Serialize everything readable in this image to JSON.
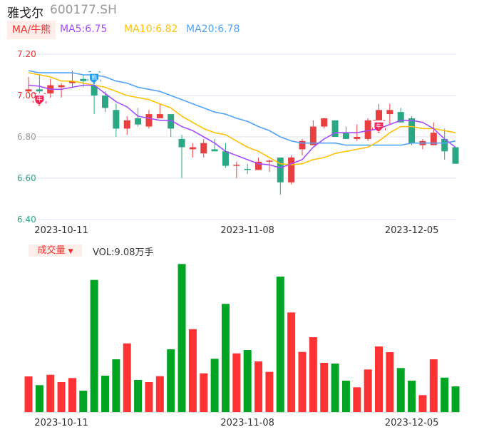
{
  "header": {
    "name": "雅戈尔",
    "code": "600177.SH"
  },
  "indicator": {
    "selector_label": "MA/牛熊",
    "ma5": {
      "label": "MA5:6.75",
      "color": "#a64dff"
    },
    "ma10": {
      "label": "MA10:6.82",
      "color": "#ffc107"
    },
    "ma20": {
      "label": "MA20:6.78",
      "color": "#4fa3f7"
    }
  },
  "volume_panel": {
    "selector_label": "成交量",
    "value_label": "VOL:9.08万手"
  },
  "colors": {
    "up": "#e84040",
    "down": "#2aa784",
    "vol_up": "#ff3333",
    "vol_down": "#00a524",
    "grid": "#dde3ef"
  },
  "chart_data": {
    "type": "candlestick",
    "y_ticks": [
      "7.20",
      "7.00",
      "6.80",
      "6.60",
      "6.40"
    ],
    "ylim": [
      6.4,
      7.2
    ],
    "x_tick_labels": [
      {
        "index": 3,
        "label": "2023-10-11"
      },
      {
        "index": 20,
        "label": "2023-11-08"
      },
      {
        "index": 35,
        "label": "2023-12-05"
      }
    ],
    "ohlc": [
      [
        7.02,
        7.09,
        7.01,
        7.03
      ],
      [
        7.03,
        7.1,
        7.01,
        7.02
      ],
      [
        7.01,
        7.08,
        6.99,
        7.05
      ],
      [
        7.04,
        7.06,
        6.99,
        7.05
      ],
      [
        7.06,
        7.12,
        7.04,
        7.07
      ],
      [
        7.08,
        7.1,
        7.04,
        7.07
      ],
      [
        7.05,
        7.06,
        6.91,
        7.0
      ],
      [
        7.0,
        7.02,
        6.92,
        6.94
      ],
      [
        6.93,
        6.96,
        6.8,
        6.84
      ],
      [
        6.84,
        6.9,
        6.81,
        6.88
      ],
      [
        6.89,
        6.94,
        6.85,
        6.86
      ],
      [
        6.85,
        6.93,
        6.84,
        6.91
      ],
      [
        6.89,
        6.96,
        6.89,
        6.91
      ],
      [
        6.91,
        6.91,
        6.8,
        6.84
      ],
      [
        6.79,
        6.81,
        6.6,
        6.75
      ],
      [
        6.74,
        6.77,
        6.7,
        6.75
      ],
      [
        6.72,
        6.79,
        6.7,
        6.77
      ],
      [
        6.74,
        6.79,
        6.73,
        6.73
      ],
      [
        6.73,
        6.77,
        6.65,
        6.66
      ],
      [
        6.66,
        6.68,
        6.6,
        6.665
      ],
      [
        6.645,
        6.67,
        6.62,
        6.64
      ],
      [
        6.64,
        6.7,
        6.64,
        6.68
      ],
      [
        6.68,
        6.69,
        6.63,
        6.685
      ],
      [
        6.7,
        6.7,
        6.52,
        6.58
      ],
      [
        6.58,
        6.71,
        6.57,
        6.7
      ],
      [
        6.74,
        6.79,
        6.71,
        6.78
      ],
      [
        6.76,
        6.88,
        6.76,
        6.85
      ],
      [
        6.85,
        6.89,
        6.84,
        6.89
      ],
      [
        6.88,
        6.88,
        6.8,
        6.8
      ],
      [
        6.82,
        6.85,
        6.79,
        6.79
      ],
      [
        6.79,
        6.86,
        6.78,
        6.8
      ],
      [
        6.79,
        6.89,
        6.78,
        6.88
      ],
      [
        6.88,
        6.96,
        6.88,
        6.93
      ],
      [
        6.91,
        6.96,
        6.86,
        6.93
      ],
      [
        6.92,
        6.94,
        6.87,
        6.87
      ],
      [
        6.89,
        6.9,
        6.76,
        6.77
      ],
      [
        6.76,
        6.79,
        6.74,
        6.78
      ],
      [
        6.76,
        6.87,
        6.76,
        6.82
      ],
      [
        6.79,
        6.84,
        6.69,
        6.73
      ],
      [
        6.75,
        6.75,
        6.67,
        6.67
      ]
    ],
    "ma5": [
      7.05,
      7.045,
      7.03,
      7.03,
      7.04,
      7.05,
      7.05,
      7.01,
      6.97,
      6.945,
      6.9,
      6.89,
      6.88,
      6.88,
      6.85,
      6.83,
      6.8,
      6.77,
      6.73,
      6.71,
      6.69,
      6.67,
      6.665,
      6.65,
      6.67,
      6.69,
      6.75,
      6.79,
      6.82,
      6.82,
      6.82,
      6.83,
      6.84,
      6.86,
      6.88,
      6.88,
      6.87,
      6.84,
      6.79,
      6.75
    ],
    "ma10": [
      7.11,
      7.1,
      7.09,
      7.07,
      7.07,
      7.06,
      7.05,
      7.04,
      7.02,
      7.0,
      6.99,
      6.98,
      6.96,
      6.94,
      6.9,
      6.87,
      6.84,
      6.82,
      6.81,
      6.78,
      6.75,
      6.73,
      6.7,
      6.67,
      6.665,
      6.67,
      6.69,
      6.7,
      6.72,
      6.73,
      6.74,
      6.75,
      6.78,
      6.82,
      6.85,
      6.85,
      6.84,
      6.84,
      6.83,
      6.82
    ],
    "ma20": [
      7.12,
      7.11,
      7.11,
      7.11,
      7.11,
      7.1,
      7.1,
      7.09,
      7.07,
      7.06,
      7.04,
      7.03,
      7.02,
      7.0,
      6.98,
      6.96,
      6.94,
      6.92,
      6.91,
      6.89,
      6.875,
      6.85,
      6.83,
      6.8,
      6.78,
      6.77,
      6.77,
      6.77,
      6.77,
      6.76,
      6.76,
      6.76,
      6.76,
      6.76,
      6.76,
      6.77,
      6.77,
      6.77,
      6.77,
      6.78
    ],
    "volume_wan": [
      12.61,
      9.51,
      13.19,
      10.59,
      12.03,
      7.57,
      46.74,
      12.86,
      18.66,
      24.29,
      11.35,
      10.59,
      12.69,
      22.19,
      52.38,
      29.33,
      13.69,
      18.84,
      38.26,
      20.76,
      21.94,
      17.91,
      14.2,
      47.92,
      35.23,
      21.26,
      26.48,
      17.4,
      17.15,
      11.1,
      8.75,
      15.06,
      23.2,
      21.18,
      15.56,
      11.1,
      5.98,
      18.66,
      12.18,
      9.08
    ],
    "signals": [
      {
        "index": 1,
        "label": "牛",
        "color": "#f0285a"
      },
      {
        "index": 6,
        "label": "熊",
        "color": "#1e9bf0"
      },
      {
        "index": 32,
        "label": "牛",
        "color": "#f0285a"
      }
    ]
  }
}
